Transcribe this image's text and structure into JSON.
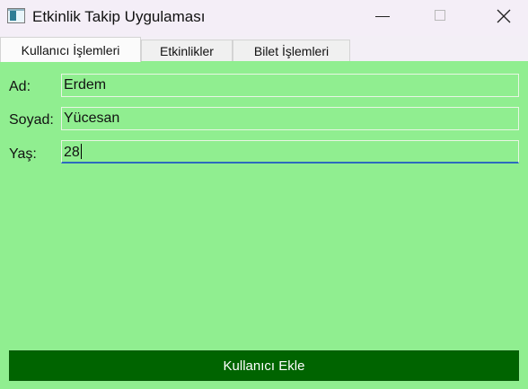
{
  "window": {
    "title": "Etkinlik Takip Uygulaması"
  },
  "tabs": [
    {
      "label": "Kullanıcı İşlemleri",
      "selected": true
    },
    {
      "label": "Etkinlikler",
      "selected": false
    },
    {
      "label": "Bilet İşlemleri",
      "selected": false
    }
  ],
  "form": {
    "fields": [
      {
        "label": "Ad:",
        "value": "Erdem"
      },
      {
        "label": "Soyad:",
        "value": "Yücesan"
      },
      {
        "label": "Yaş:",
        "value": "28"
      }
    ],
    "submit_label": "Kullanıcı Ekle"
  },
  "colors": {
    "panel_background": "#90ee90",
    "button_background": "#006400",
    "button_text": "#ffffff",
    "focus_underline": "#2c6bbd"
  },
  "icons": [
    "app-window-icon",
    "minimize-icon",
    "maximize-icon",
    "close-icon"
  ]
}
